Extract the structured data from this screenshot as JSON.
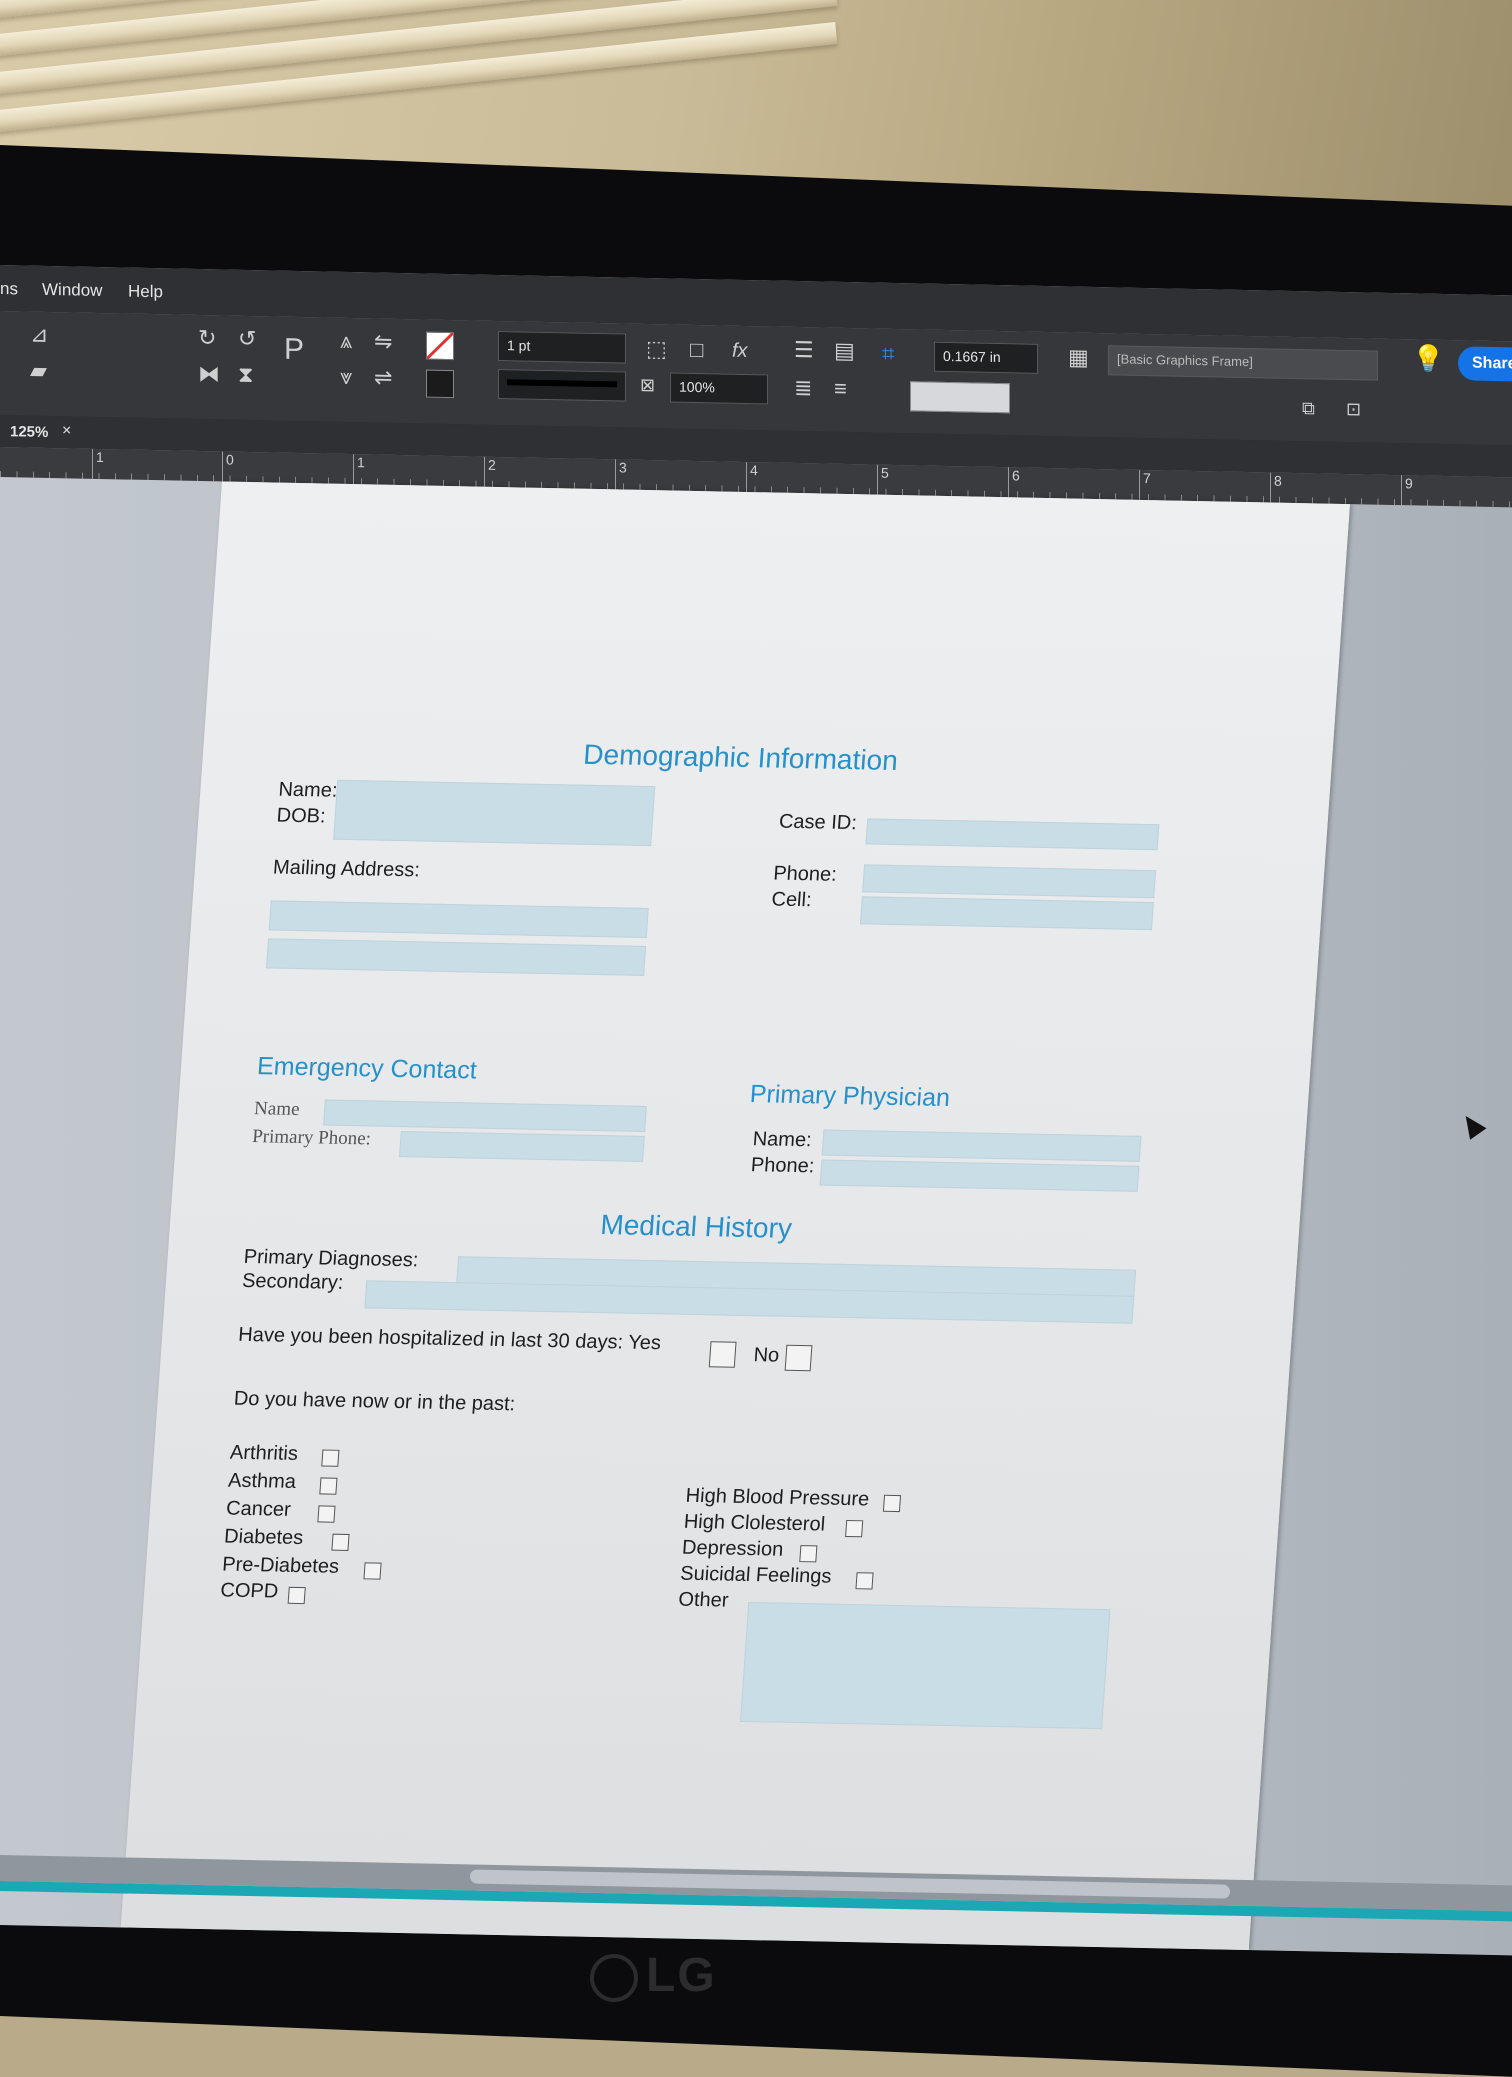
{
  "menu": {
    "items": [
      "ns",
      "Window",
      "Help"
    ]
  },
  "toolbar": {
    "stroke_weight": "1 pt",
    "opacity": "100%",
    "dimension": "0.1667 in",
    "object_style": "[Basic Graphics Frame]",
    "share_label": "Share"
  },
  "tab": {
    "zoom": "125%",
    "close": "×"
  },
  "ruler": {
    "labels": [
      "1",
      "0",
      "1",
      "2",
      "3",
      "4",
      "5",
      "6",
      "7",
      "8",
      "9"
    ]
  },
  "form": {
    "demographic": {
      "heading": "Demographic Information",
      "name": "Name:",
      "dob": "DOB:",
      "case_id": "Case ID:",
      "mailing": "Mailing Address:",
      "phone": "Phone:",
      "cell": "Cell:"
    },
    "emergency": {
      "heading": "Emergency Contact",
      "name": "Name",
      "phone": "Primary Phone:"
    },
    "physician": {
      "heading": "Primary Physician",
      "name": "Name:",
      "phone": "Phone:"
    },
    "medical": {
      "heading": "Medical History",
      "primary": "Primary Diagnoses:",
      "secondary": "Secondary:",
      "hospitalized": "Have you been hospitalized in last 30 days: Yes",
      "no": "No",
      "question": "Do you have now or in the past:",
      "left_conditions": [
        "Arthritis",
        "Asthma",
        "Cancer",
        "Diabetes",
        "Pre-Diabetes",
        "COPD"
      ],
      "right_conditions": [
        "High Blood Pressure",
        "High Clolesterol",
        "Depression",
        "Suicidal Feelings"
      ],
      "other": "Other"
    }
  },
  "monitor": {
    "brand": "LG"
  }
}
